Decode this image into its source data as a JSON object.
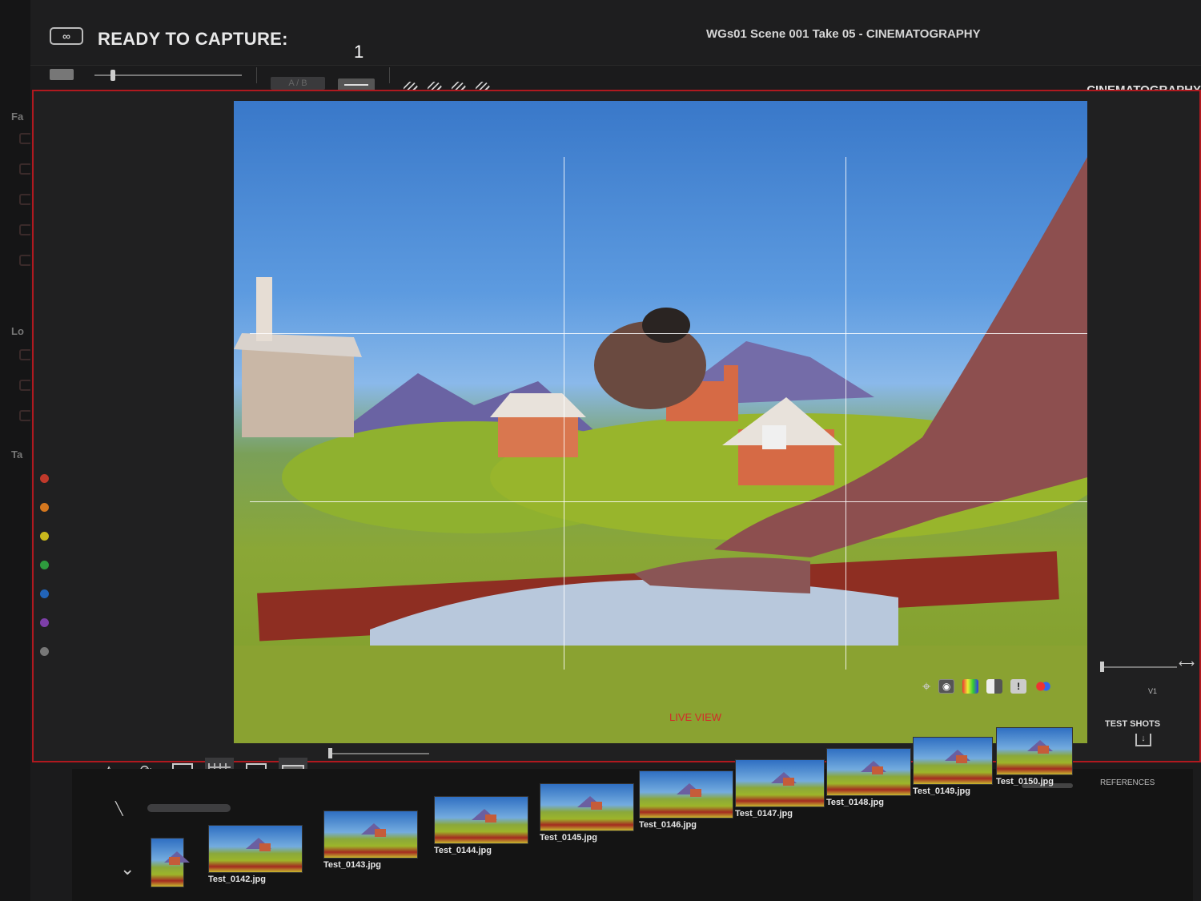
{
  "header": {
    "ready_label": "READY TO CAPTURE:",
    "ready_count": "1",
    "take_title": "WGs01  Scene 001  Take 05 - CINEMATOGRAPHY",
    "department": "CINEMATOGRAPHY"
  },
  "toolbar": {
    "ab_label": "A / B"
  },
  "viewer": {
    "mode_label": "LIVE VIEW",
    "version_label": "V1"
  },
  "filmstrip": {
    "test_shots_label": "TEST SHOTS",
    "references_label": "REFERENCES",
    "thumbnails": [
      "Test_0142.jpg",
      "Test_0143.jpg",
      "Test_0144.jpg",
      "Test_0145.jpg",
      "Test_0146.jpg",
      "Test_0147.jpg",
      "Test_0148.jpg",
      "Test_0149.jpg",
      "Test_0150.jpg"
    ]
  },
  "sidebar": {
    "sections": [
      "Fa",
      "Lo",
      "Ta"
    ]
  },
  "colors": {
    "accent_red": "#b0191f",
    "live_view_red": "#d22a2a"
  }
}
